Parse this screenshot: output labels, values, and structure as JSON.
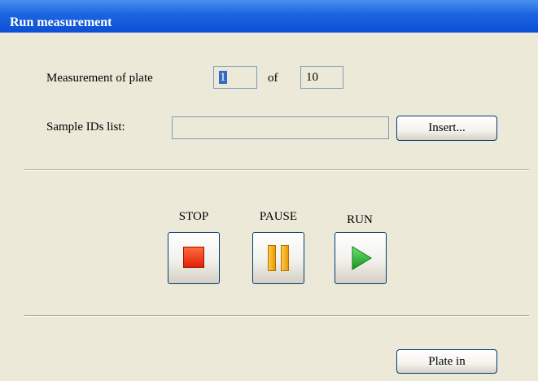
{
  "window": {
    "title": "Run measurement"
  },
  "plate": {
    "label": "Measurement of plate",
    "current": "1",
    "of_label": "of",
    "total": "10"
  },
  "samples": {
    "label": "Sample IDs list:",
    "value": "",
    "insert_button": "Insert..."
  },
  "controls": {
    "stop_label": "STOP",
    "pause_label": "PAUSE",
    "run_label": "RUN",
    "icons": [
      "stop-icon",
      "pause-icon",
      "play-icon"
    ],
    "colors": {
      "stop": "#e8330f",
      "pause": "#f0a800",
      "run": "#22b022"
    }
  },
  "footer": {
    "plate_in_button": "Plate in"
  }
}
